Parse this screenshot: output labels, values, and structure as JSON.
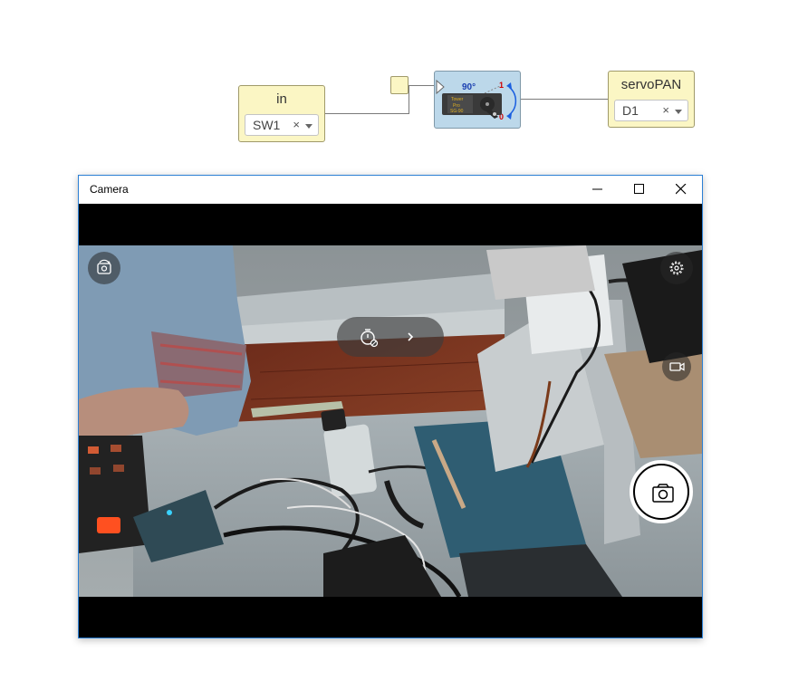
{
  "graph": {
    "in_node": {
      "title": "in",
      "value": "SW1",
      "clear": "×"
    },
    "servo_node": {
      "angle": "90°",
      "max": "1",
      "min": "0",
      "brand_lines": [
        "Tower",
        "Pro",
        "SG-90"
      ]
    },
    "out_node": {
      "title": "servoPAN",
      "value": "D1",
      "clear": "×"
    }
  },
  "camera": {
    "title": "Camera",
    "icons": {
      "minimize": "minimize-icon",
      "maximize": "maximize-icon",
      "close": "close-icon",
      "camera_switch": "camera-switch-icon",
      "timer": "timer-off-icon",
      "chevron": "chevron-right-icon",
      "settings": "gear-icon",
      "video": "video-camera-icon",
      "shutter": "camera-icon"
    }
  }
}
